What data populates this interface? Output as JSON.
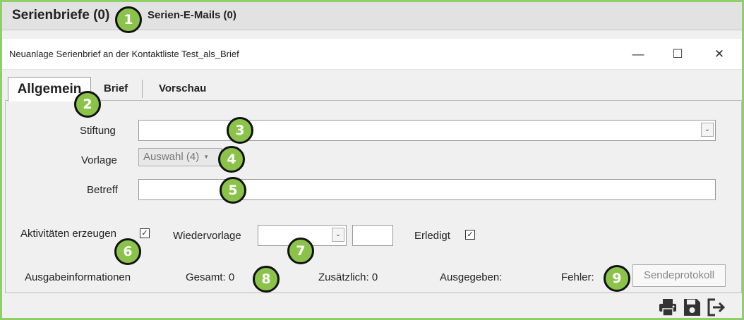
{
  "outer_tabs": [
    {
      "label": "Serienbriefe (0)"
    },
    {
      "label": "Serien-E-Mails (0)"
    }
  ],
  "window": {
    "title": "Neuanlage Serienbrief an der Kontaktliste Test_als_Brief",
    "minimize": "—",
    "maximize": "☐",
    "close": "✕"
  },
  "inner_tabs": [
    {
      "label": "Allgemein"
    },
    {
      "label": "Brief"
    },
    {
      "label": "Vorschau"
    }
  ],
  "form": {
    "stiftung_label": "Stiftung",
    "stiftung_value": "",
    "vorlage_label": "Vorlage",
    "vorlage_value": "Auswahl (4)",
    "betreff_label": "Betreff",
    "betreff_value": ""
  },
  "options": {
    "aktivitaeten_label": "Aktivitäten erzeugen",
    "aktivitaeten_checked": true,
    "wiedervorlage_label": "Wiedervorlage",
    "wiedervorlage_value": "",
    "wiedervorlage_extra": "",
    "erledigt_label": "Erledigt",
    "erledigt_checked": true
  },
  "output": {
    "label": "Ausgabeinformationen",
    "gesamt": "Gesamt: 0",
    "zusaetzlich": "Zusätzlich: 0",
    "ausgegeben": "Ausgegeben:",
    "fehler": "Fehler:",
    "sendeprotokoll": "Sendeprotokoll"
  },
  "footer_icons": [
    "print-icon",
    "save-icon",
    "exit-icon"
  ],
  "badges": [
    "1",
    "2",
    "3",
    "4",
    "5",
    "6",
    "7",
    "8",
    "9"
  ],
  "colors": {
    "accent_green": "#8bc34a",
    "frame_green": "#8fcf6a"
  }
}
